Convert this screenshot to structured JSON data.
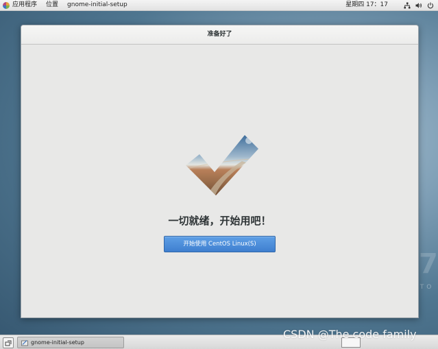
{
  "top_bar": {
    "applications_label": "应用程序",
    "places_label": "位置",
    "active_app_label": "gnome-initial-setup",
    "clock": "星期四 17：17",
    "icons": [
      "network-icon",
      "volume-icon",
      "power-icon"
    ]
  },
  "window": {
    "title": "准备好了",
    "heading": "一切就绪，开始用吧！",
    "start_button_label": "开始使用 CentOS Linux(S)",
    "accent_color": "#4a8bdb"
  },
  "desktop": {
    "logo_digit": "7",
    "logo_text": "NTO"
  },
  "taskbar": {
    "task_label": "gnome-initial-setup"
  },
  "watermark": "CSDN @The code family"
}
